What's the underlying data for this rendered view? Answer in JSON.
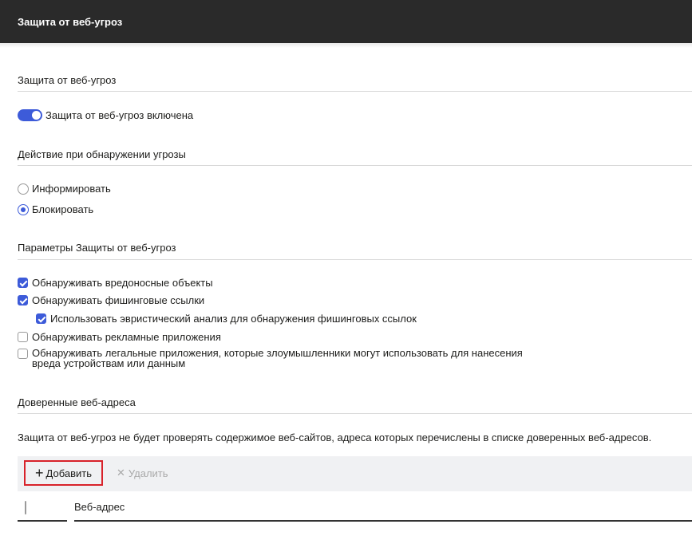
{
  "header": {
    "title": "Защита от веб-угроз"
  },
  "sections": {
    "protection": {
      "title": "Защита от веб-угроз",
      "toggle_label": "Защита от веб-угроз включена",
      "enabled": true
    },
    "action": {
      "title": "Действие при обнаружении угрозы",
      "options": [
        {
          "label": "Информировать",
          "selected": false
        },
        {
          "label": "Блокировать",
          "selected": true
        }
      ]
    },
    "params": {
      "title": "Параметры Защиты от веб-угроз",
      "items": [
        {
          "label": "Обнаруживать вредоносные объекты",
          "checked": true
        },
        {
          "label": "Обнаруживать фишинговые ссылки",
          "checked": true
        },
        {
          "label": "Использовать эвристический анализ для обнаружения фишинговых ссылок",
          "checked": true
        },
        {
          "label": "Обнаруживать рекламные приложения",
          "checked": false
        },
        {
          "label": "Обнаруживать легальные приложения, которые злоумышленники могут использовать для нанесения вреда устройствам или данным",
          "checked": false
        }
      ]
    },
    "trusted": {
      "title": "Доверенные веб-адреса",
      "description": "Защита от веб-угроз не будет проверять содержимое веб-сайтов, адреса которых перечислены в списке доверенных веб-адресов.",
      "toolbar": {
        "add_label": "Добавить",
        "delete_label": "Удалить"
      },
      "table": {
        "column_url": "Веб-адрес"
      }
    }
  },
  "colors": {
    "accent": "#3d5bd9",
    "header_bg": "#2a2a2a",
    "highlight": "#d8222a",
    "toolbar_bg": "#f0f1f3"
  }
}
